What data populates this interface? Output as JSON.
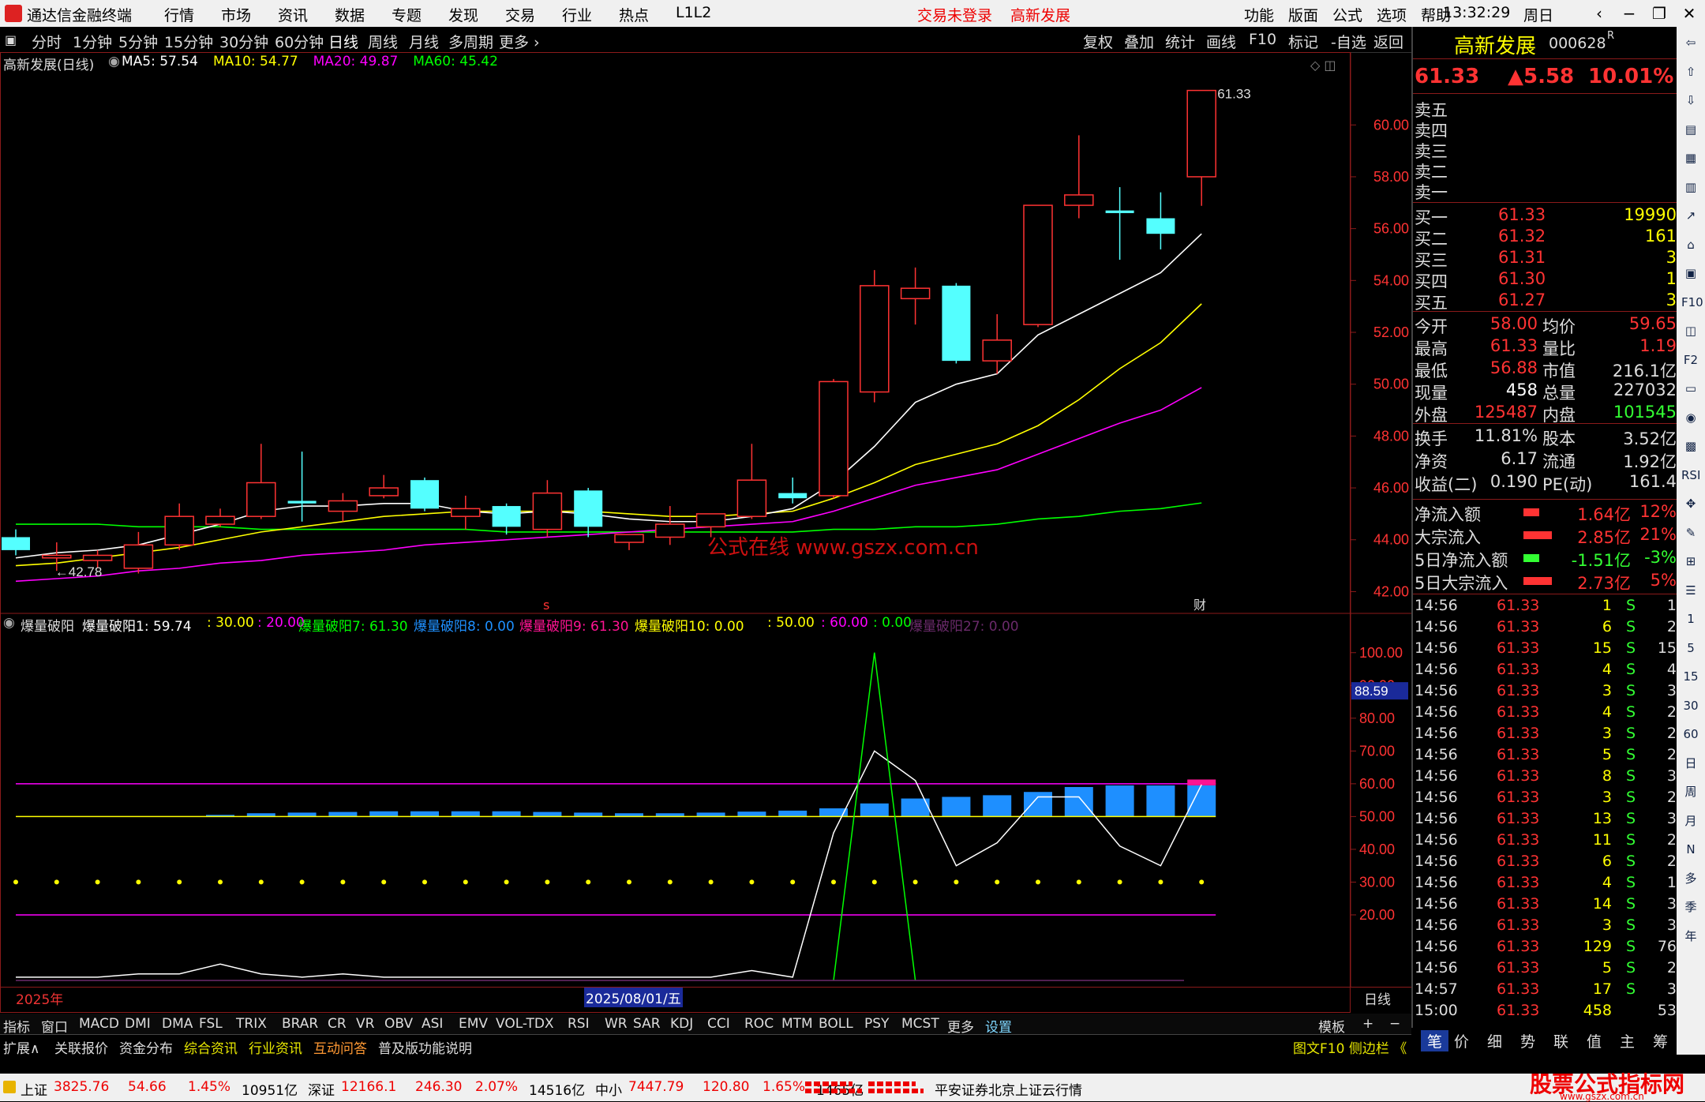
{
  "window": {
    "app_title": "通达信金融终端",
    "time": "13:32:29",
    "weekday": "周日"
  },
  "menu": {
    "left": [
      "行情",
      "市场",
      "资讯",
      "数据",
      "专题",
      "发现",
      "交易",
      "行业",
      "热点",
      "L1L2"
    ],
    "status": [
      "交易未登录",
      "高新发展"
    ],
    "right": [
      "功能",
      "版面",
      "公式",
      "选项",
      "帮助"
    ]
  },
  "periods": [
    "分时",
    "1分钟",
    "5分钟",
    "15分钟",
    "30分钟",
    "60分钟",
    "日线",
    "周线",
    "月线",
    "多周期",
    "更多 ›"
  ],
  "chart_tools": [
    "复权",
    "叠加",
    "统计",
    "画线",
    "F10",
    "标记",
    "-自选",
    "返回"
  ],
  "main_chart": {
    "title": "高新发展(日线)",
    "ma": [
      {
        "name": "MA5: 57.54",
        "color": "#ffffff"
      },
      {
        "name": "MA10: 54.77",
        "color": "#ffff00"
      },
      {
        "name": "MA20: 49.87",
        "color": "#ff00ff"
      },
      {
        "name": "MA60: 45.42",
        "color": "#00ff00"
      }
    ],
    "high_label": "61.33",
    "low_label": "42.78",
    "watermark": "公式在线  www.gszx.com.cn",
    "marker_s": "s",
    "marker_cai": "财"
  },
  "sub_chart": {
    "title": "爆量破阳",
    "legend": [
      {
        "text": "爆量破阳1: 59.74",
        "color": "#ffffff"
      },
      {
        "text": ": 30.00",
        "color": "#ffff00"
      },
      {
        "text": ": 20.00",
        "color": "#ff00ff"
      },
      {
        "text": "爆量破阳7: 61.30",
        "color": "#00ff00"
      },
      {
        "text": "爆量破阳8: 0.00",
        "color": "#1e90ff"
      },
      {
        "text": "爆量破阳9: 61.30",
        "color": "#ff1493"
      },
      {
        "text": "爆量破阳10: 0.00",
        "color": "#ffff00"
      },
      {
        "text": ": 50.00",
        "color": "#ffff00"
      },
      {
        "text": ": 60.00",
        "color": "#ff00ff"
      },
      {
        "text": ": 0.00",
        "color": "#00ff00"
      },
      {
        "text": "爆量破阳27: 0.00",
        "color": "#6a2a6a"
      }
    ],
    "cursor_value": "88.59"
  },
  "dates": {
    "year": "2025年",
    "cursor": "2025/08/01/五",
    "period": "日线"
  },
  "chart_data": [
    {
      "type": "candlestick",
      "title": "高新发展(日线)",
      "ylim": [
        41.8,
        62.2
      ],
      "yticks": [
        "60.00",
        "58.00",
        "56.00",
        "54.00",
        "52.00",
        "50.00",
        "48.00",
        "46.00",
        "44.00",
        "42.00"
      ],
      "candles": [
        {
          "o": 44.1,
          "h": 44.4,
          "l": 43.4,
          "c": 43.6
        },
        {
          "o": 43.3,
          "h": 43.9,
          "l": 42.8,
          "c": 43.4
        },
        {
          "o": 43.2,
          "h": 43.6,
          "l": 42.9,
          "c": 43.4
        },
        {
          "o": 42.9,
          "h": 44.3,
          "l": 42.7,
          "c": 43.8
        },
        {
          "o": 43.8,
          "h": 45.4,
          "l": 43.6,
          "c": 44.9
        },
        {
          "o": 44.6,
          "h": 45.2,
          "l": 44.5,
          "c": 44.9
        },
        {
          "o": 44.9,
          "h": 47.7,
          "l": 44.8,
          "c": 46.2
        },
        {
          "o": 45.5,
          "h": 47.4,
          "l": 44.7,
          "c": 45.4
        },
        {
          "o": 45.1,
          "h": 45.8,
          "l": 44.7,
          "c": 45.5
        },
        {
          "o": 45.7,
          "h": 46.5,
          "l": 45.6,
          "c": 46.0
        },
        {
          "o": 46.3,
          "h": 46.4,
          "l": 45.1,
          "c": 45.2
        },
        {
          "o": 44.9,
          "h": 45.7,
          "l": 44.4,
          "c": 45.2
        },
        {
          "o": 45.3,
          "h": 45.4,
          "l": 44.2,
          "c": 44.5
        },
        {
          "o": 44.4,
          "h": 46.3,
          "l": 44.1,
          "c": 45.8
        },
        {
          "o": 45.9,
          "h": 46.0,
          "l": 44.1,
          "c": 44.5
        },
        {
          "o": 43.9,
          "h": 44.2,
          "l": 43.6,
          "c": 44.2
        },
        {
          "o": 44.1,
          "h": 45.3,
          "l": 43.8,
          "c": 44.6
        },
        {
          "o": 44.5,
          "h": 45.0,
          "l": 44.1,
          "c": 45.0
        },
        {
          "o": 44.9,
          "h": 47.7,
          "l": 44.8,
          "c": 46.3
        },
        {
          "o": 45.8,
          "h": 46.4,
          "l": 45.4,
          "c": 45.6
        },
        {
          "o": 45.7,
          "h": 50.2,
          "l": 45.6,
          "c": 50.1
        },
        {
          "o": 49.7,
          "h": 54.4,
          "l": 49.3,
          "c": 53.8
        },
        {
          "o": 53.3,
          "h": 54.5,
          "l": 52.3,
          "c": 53.7
        },
        {
          "o": 53.8,
          "h": 53.9,
          "l": 50.8,
          "c": 50.9
        },
        {
          "o": 50.9,
          "h": 52.7,
          "l": 50.4,
          "c": 51.7
        },
        {
          "o": 52.3,
          "h": 56.9,
          "l": 52.2,
          "c": 56.9
        },
        {
          "o": 56.9,
          "h": 59.6,
          "l": 56.4,
          "c": 57.3
        },
        {
          "o": 56.7,
          "h": 57.6,
          "l": 54.8,
          "c": 56.6
        },
        {
          "o": 56.4,
          "h": 57.4,
          "l": 55.2,
          "c": 55.8
        },
        {
          "o": 58.0,
          "h": 61.33,
          "l": 56.88,
          "c": 61.33
        }
      ],
      "ma5": [
        43.3,
        43.5,
        43.6,
        43.8,
        44.2,
        44.6,
        45.1,
        45.3,
        45.3,
        45.4,
        45.4,
        45.1,
        45.0,
        45.1,
        45.0,
        44.8,
        44.7,
        44.7,
        44.9,
        45.2,
        46.2,
        47.6,
        49.3,
        50.0,
        50.4,
        51.9,
        52.7,
        53.5,
        54.3,
        55.8
      ],
      "ma10": [
        43.0,
        43.1,
        43.3,
        43.5,
        43.7,
        44.0,
        44.3,
        44.5,
        44.7,
        44.9,
        45.0,
        45.1,
        45.1,
        45.1,
        45.1,
        45.0,
        44.9,
        44.9,
        45.0,
        45.1,
        45.6,
        46.2,
        46.9,
        47.3,
        47.7,
        48.4,
        49.4,
        50.6,
        51.6,
        53.1
      ],
      "ma20": [
        42.4,
        42.5,
        42.6,
        42.8,
        42.9,
        43.1,
        43.2,
        43.4,
        43.5,
        43.6,
        43.8,
        43.9,
        44.0,
        44.1,
        44.2,
        44.3,
        44.4,
        44.5,
        44.6,
        44.7,
        45.1,
        45.6,
        46.1,
        46.4,
        46.7,
        47.3,
        47.9,
        48.5,
        49.0,
        49.87
      ],
      "ma60": [
        44.6,
        44.6,
        44.6,
        44.5,
        44.5,
        44.5,
        44.4,
        44.4,
        44.4,
        44.4,
        44.4,
        44.4,
        44.3,
        44.3,
        44.3,
        44.3,
        44.3,
        44.3,
        44.3,
        44.3,
        44.4,
        44.4,
        44.5,
        44.5,
        44.6,
        44.8,
        44.9,
        45.1,
        45.2,
        45.42
      ]
    },
    {
      "type": "indicator",
      "title": "爆量破阳",
      "ylim": [
        0,
        105
      ],
      "yticks": [
        "100.00",
        "90.00",
        "80.00",
        "70.00",
        "60.00",
        "50.00",
        "40.00",
        "30.00",
        "20.00"
      ],
      "lines": {
        "l50": 50,
        "l60": 60,
        "l20": 20,
        "dots": 30
      },
      "white": [
        1,
        1,
        1,
        2,
        2,
        5,
        2,
        1,
        2,
        1,
        1,
        1,
        1,
        1,
        1,
        1,
        1,
        1,
        3,
        1,
        45,
        70,
        61,
        35,
        42,
        56,
        56,
        41,
        35,
        59.74
      ],
      "green_spike_index": 21,
      "green_spike_value": 100,
      "bars": [
        0,
        0,
        0,
        0,
        0,
        0.5,
        1,
        1.2,
        1.4,
        1.6,
        1.6,
        1.6,
        1.6,
        1.4,
        1.2,
        1.0,
        1.0,
        1.2,
        1.5,
        1.8,
        2.5,
        4.0,
        5.5,
        6.0,
        6.5,
        7.5,
        9.0,
        9.5,
        9.5,
        9.5
      ],
      "pink_top": 61.3
    }
  ],
  "indicator_tabs": [
    "指标",
    "窗口",
    "MACD",
    "DMI",
    "DMA",
    "FSL",
    "TRIX",
    "BRAR",
    "CR",
    "VR",
    "OBV",
    "ASI",
    "EMV",
    "VOL-TDX",
    "RSI",
    "WR",
    "SAR",
    "KDJ",
    "CCI",
    "ROC",
    "MTM",
    "BOLL",
    "PSY",
    "MCST",
    "更多",
    "设置"
  ],
  "indicator_tabs_right": [
    "模板",
    "+",
    "−"
  ],
  "ext_tabs": [
    "扩展∧",
    "关联报价",
    "资金分布",
    "综合资讯",
    "行业资讯",
    "互动问答",
    "普及版功能说明"
  ],
  "ext_right": "图文F10 侧边栏 《",
  "right_tabs": [
    "笔",
    "价",
    "细",
    "势",
    "联",
    "值",
    "主",
    "筹"
  ],
  "quote": {
    "name": "高新发展",
    "code": "000628",
    "mark": "R",
    "price": "61.33",
    "change": "▲5.58",
    "pct": "10.01%",
    "sells": [
      "卖五",
      "卖四",
      "卖三",
      "卖二",
      "卖一"
    ],
    "buys": [
      {
        "l": "买一",
        "p": "61.33",
        "v": "19990"
      },
      {
        "l": "买二",
        "p": "61.32",
        "v": "161"
      },
      {
        "l": "买三",
        "p": "61.31",
        "v": "3"
      },
      {
        "l": "买四",
        "p": "61.30",
        "v": "1"
      },
      {
        "l": "买五",
        "p": "61.27",
        "v": "3"
      }
    ],
    "stats": [
      {
        "l1": "今开",
        "v1": "58.00",
        "l2": "均价",
        "v2": "59.65",
        "c1": "#ff3333",
        "c2": "#ff3333"
      },
      {
        "l1": "最高",
        "v1": "61.33",
        "l2": "量比",
        "v2": "1.19",
        "c1": "#ff3333",
        "c2": "#ff3333"
      },
      {
        "l1": "最低",
        "v1": "56.88",
        "l2": "市值",
        "v2": "216.1亿",
        "c1": "#ff3333",
        "c2": "#dddddd"
      },
      {
        "l1": "现量",
        "v1": "458",
        "l2": "总量",
        "v2": "227032",
        "c1": "#ffffff",
        "c2": "#dddddd"
      },
      {
        "l1": "外盘",
        "v1": "125487",
        "l2": "内盘",
        "v2": "101545",
        "c1": "#ff3333",
        "c2": "#33ff33"
      }
    ],
    "stats2": [
      {
        "l1": "换手",
        "v1": "11.81%",
        "l2": "股本",
        "v2": "3.52亿"
      },
      {
        "l1": "净资",
        "v1": "6.17",
        "l2": "流通",
        "v2": "1.92亿"
      },
      {
        "l1": "收益(二)",
        "v1": "0.190",
        "l2": "PE(动)",
        "v2": "161.4"
      }
    ],
    "flows": [
      {
        "l": "净流入额",
        "v": "1.64亿",
        "p": "12%",
        "c": "#ff3333"
      },
      {
        "l": "大宗流入",
        "v": "2.85亿",
        "p": "21%",
        "c": "#ff3333"
      },
      {
        "l": "5日净流入额",
        "v": "-1.51亿",
        "p": "-3%",
        "c": "#33ff33"
      },
      {
        "l": "5日大宗流入",
        "v": "2.73亿",
        "p": "5%",
        "c": "#ff3333"
      }
    ],
    "ticks": [
      {
        "t": "14:56",
        "p": "61.33",
        "v": "1",
        "s": "S",
        "n": "1"
      },
      {
        "t": "14:56",
        "p": "61.33",
        "v": "6",
        "s": "S",
        "n": "2"
      },
      {
        "t": "14:56",
        "p": "61.33",
        "v": "15",
        "s": "S",
        "n": "15"
      },
      {
        "t": "14:56",
        "p": "61.33",
        "v": "4",
        "s": "S",
        "n": "4"
      },
      {
        "t": "14:56",
        "p": "61.33",
        "v": "3",
        "s": "S",
        "n": "3"
      },
      {
        "t": "14:56",
        "p": "61.33",
        "v": "4",
        "s": "S",
        "n": "2"
      },
      {
        "t": "14:56",
        "p": "61.33",
        "v": "3",
        "s": "S",
        "n": "2"
      },
      {
        "t": "14:56",
        "p": "61.33",
        "v": "5",
        "s": "S",
        "n": "2"
      },
      {
        "t": "14:56",
        "p": "61.33",
        "v": "8",
        "s": "S",
        "n": "3"
      },
      {
        "t": "14:56",
        "p": "61.33",
        "v": "3",
        "s": "S",
        "n": "2"
      },
      {
        "t": "14:56",
        "p": "61.33",
        "v": "13",
        "s": "S",
        "n": "3"
      },
      {
        "t": "14:56",
        "p": "61.33",
        "v": "11",
        "s": "S",
        "n": "2"
      },
      {
        "t": "14:56",
        "p": "61.33",
        "v": "6",
        "s": "S",
        "n": "2"
      },
      {
        "t": "14:56",
        "p": "61.33",
        "v": "4",
        "s": "S",
        "n": "1"
      },
      {
        "t": "14:56",
        "p": "61.33",
        "v": "14",
        "s": "S",
        "n": "3"
      },
      {
        "t": "14:56",
        "p": "61.33",
        "v": "3",
        "s": "S",
        "n": "3"
      },
      {
        "t": "14:56",
        "p": "61.33",
        "v": "129",
        "s": "S",
        "n": "76"
      },
      {
        "t": "14:56",
        "p": "61.33",
        "v": "5",
        "s": "S",
        "n": "2"
      },
      {
        "t": "14:57",
        "p": "61.33",
        "v": "17",
        "s": "S",
        "n": "3"
      },
      {
        "t": "15:00",
        "p": "61.33",
        "v": "458",
        "s": "",
        "n": "53"
      }
    ]
  },
  "status_bar": {
    "indices": [
      {
        "name": "上证",
        "val": "3825.76",
        "chg": "54.66",
        "pct": "1.45%",
        "amt": "10951亿"
      },
      {
        "name": "深证",
        "val": "12166.1",
        "chg": "246.30",
        "pct": "2.07%",
        "amt": "14516亿"
      },
      {
        "name": "中小",
        "val": "7447.79",
        "chg": "120.80",
        "pct": "1.65%",
        "amt": "1465亿"
      }
    ],
    "broker": "平安证券北京上证云行情",
    "brand_text": "股票公式指标网",
    "brand_url": "www.gszx.com.cn"
  },
  "side_tools": [
    "⇦",
    "⇧",
    "⇩",
    "▤",
    "▦",
    "▥",
    "↗",
    "⌂",
    "▣",
    "F10",
    "◫",
    "F2",
    "▭",
    "◉",
    "▩",
    "RSI",
    "✥",
    "✎",
    "⊞",
    "☰",
    "1",
    "5",
    "15",
    "30",
    "60",
    "日",
    "周",
    "月",
    "N",
    "多",
    "季",
    "年"
  ],
  "colors": {
    "up": "#ff3333",
    "down": "#54ffff",
    "bg": "#000000",
    "grid": "#8b1a1a",
    "axis": "#ff3333"
  }
}
